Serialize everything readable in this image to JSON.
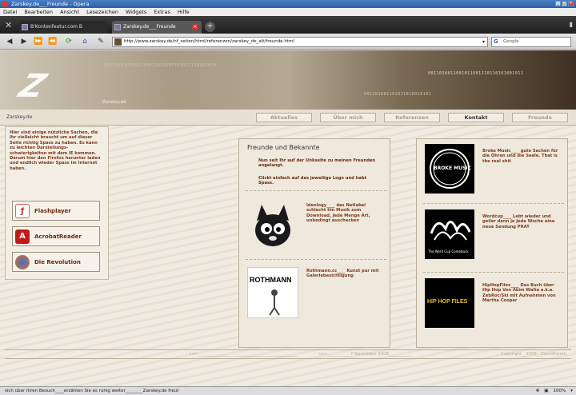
{
  "window": {
    "title": "Zarskey.de___Freunde - Opera"
  },
  "menu": [
    "Datei",
    "Bearbeiten",
    "Ansicht",
    "Lesezeichen",
    "Widgets",
    "Extras",
    "Hilfe"
  ],
  "tabs": [
    {
      "label": "B'Kontenfeatur.com B"
    },
    {
      "label": "Zarskey.de___Freunde"
    }
  ],
  "address": {
    "url": "http://www.zarskey.de/nf_seiten/html/referenzen/zarskey_de_alt/freunde.html",
    "search_placeholder": "Google"
  },
  "site": {
    "logo_name": "Zarskey.de",
    "sitename": "Zarskey.de",
    "binary1": "0011010101001110011010100101011110101010",
    "binary2": "0011010011001011001110110101001011",
    "binary3": "001101001101011010010101",
    "nav": [
      {
        "label": "Aktuelles"
      },
      {
        "label": "Über mich"
      },
      {
        "label": "Referenzen"
      },
      {
        "label": "Kontakt"
      },
      {
        "label": "Freunde"
      }
    ]
  },
  "left": {
    "intro": "Hier sind einige nützliche Sachen, die Ihr vielleicht braucht um auf dieser Seite richtig Spass zu haben. Es kann zu leichten Darstellungs-schwierigkeiten mit dem IE kommen. Darum hier den Firefox herunter laden und endlich wieder Spass im Internet haben.",
    "plugins": [
      {
        "label": "Flashplayer",
        "icon": "flash-icon"
      },
      {
        "label": "AcrobatReader",
        "icon": "acrobat-icon"
      },
      {
        "label": "Die Revolution",
        "icon": "firefox-icon"
      }
    ]
  },
  "middle": {
    "heading": "Freunde und Bekannte",
    "intro1": "Nun seit Ihr auf der Unkseite zu meinen Freunden angelangt.",
    "intro2": "Clickt einfach auf das jeweilige Logo und habt Spass.",
    "items": [
      {
        "text": "Ideology____ das Netlabel schlecht hin Musik zum Download, Jede Menge Art, unbedingt auschecken"
      },
      {
        "text": "Rothmann.cc____ Kunst pur mit Galeriebesichtigung",
        "logo": "ROTHMANN"
      }
    ]
  },
  "right": {
    "items": [
      {
        "text": "Broke Music____ gute Sachen für die Ohren und die Seele. That is the real shit",
        "logo": "BROKE MUSIC"
      },
      {
        "text": "Wordcup____ Lebt wieder und geiler denn je Jede Woche eine neue Sendung PRAT",
        "logo": "The Word Cup Comeback"
      },
      {
        "text": "HipHopFiles____ Das Buch über Hip Hop Von Akim Walta a.k.a. ZebRoc/Ski mit Aufnahmen von Martha Cooper",
        "logo": "HIP HOP FILES"
      }
    ]
  },
  "footer": {
    "left": "«+»_______________________________________________",
    "mid": "«+»___________7.November 2008___________",
    "right": "Copyright__2005__Zarsoftwerk"
  },
  "status": {
    "text": "sich über Ihren Besuch____erzählen Sie es ruhig weiter________Zarskey.de freut",
    "zoom": "100%"
  }
}
